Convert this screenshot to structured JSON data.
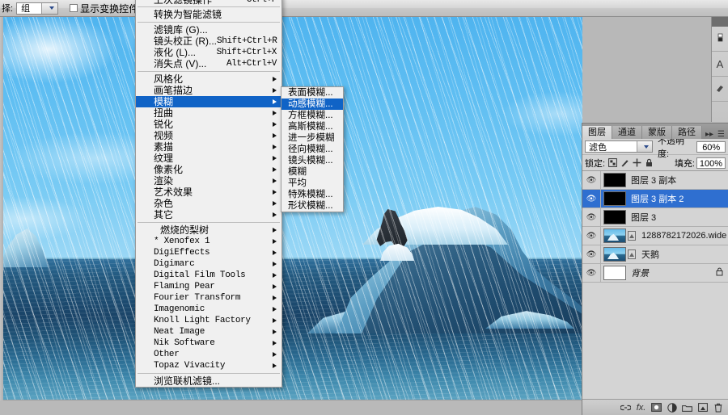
{
  "options_bar": {
    "select_label": "择:",
    "group_value": "组",
    "show_transform_label": "显示变换控件",
    "icons": [
      "align-left-icon",
      "align-horizontal-center-icon",
      "align-right-icon",
      "distribute-icon"
    ]
  },
  "filter_menu": {
    "items": [
      {
        "label": "上次滤镜操作",
        "shortcut": "Ctrl+F",
        "type": "item",
        "cut": true
      },
      {
        "type": "sep"
      },
      {
        "label": "转换为智能滤镜",
        "shortcut": "",
        "type": "item"
      },
      {
        "type": "sep"
      },
      {
        "label": "滤镜库 (G)...",
        "shortcut": "",
        "type": "item"
      },
      {
        "label": "镜头校正 (R)...",
        "shortcut": "Shift+Ctrl+R",
        "type": "item"
      },
      {
        "label": "液化 (L)...",
        "shortcut": "Shift+Ctrl+X",
        "type": "item"
      },
      {
        "label": "消失点 (V)...",
        "shortcut": "Alt+Ctrl+V",
        "type": "item"
      },
      {
        "type": "sep"
      },
      {
        "label": "风格化",
        "type": "submenu"
      },
      {
        "label": "画笔描边",
        "type": "submenu"
      },
      {
        "label": "模糊",
        "type": "submenu",
        "highlight": true
      },
      {
        "label": "扭曲",
        "type": "submenu"
      },
      {
        "label": "锐化",
        "type": "submenu"
      },
      {
        "label": "视频",
        "type": "submenu"
      },
      {
        "label": "素描",
        "type": "submenu"
      },
      {
        "label": "纹理",
        "type": "submenu"
      },
      {
        "label": "像素化",
        "type": "submenu"
      },
      {
        "label": "渲染",
        "type": "submenu"
      },
      {
        "label": "艺术效果",
        "type": "submenu"
      },
      {
        "label": "杂色",
        "type": "submenu"
      },
      {
        "label": "其它",
        "type": "submenu"
      },
      {
        "type": "sep"
      },
      {
        "label": "燃烧的梨树",
        "type": "submenu",
        "indent": true
      },
      {
        "label": "* Xenofex 1",
        "type": "submenu",
        "mono": true
      },
      {
        "label": "DigiEffects",
        "type": "submenu",
        "mono": true
      },
      {
        "label": "Digimarc",
        "type": "submenu",
        "mono": true
      },
      {
        "label": "Digital Film Tools",
        "type": "submenu",
        "mono": true
      },
      {
        "label": "Flaming Pear",
        "type": "submenu",
        "mono": true
      },
      {
        "label": "Fourier Transform",
        "type": "submenu",
        "mono": true
      },
      {
        "label": "Imagenomic",
        "type": "submenu",
        "mono": true
      },
      {
        "label": "Knoll Light Factory",
        "type": "submenu",
        "mono": true
      },
      {
        "label": "Neat Image",
        "type": "submenu",
        "mono": true
      },
      {
        "label": "Nik Software",
        "type": "submenu",
        "mono": true
      },
      {
        "label": "Other",
        "type": "submenu",
        "mono": true
      },
      {
        "label": "Topaz Vivacity",
        "type": "submenu",
        "mono": true
      },
      {
        "type": "sep"
      },
      {
        "label": "浏览联机滤镜...",
        "type": "item"
      }
    ]
  },
  "blur_submenu": {
    "items": [
      {
        "label": "表面模糊..."
      },
      {
        "label": "动感模糊...",
        "highlight": true
      },
      {
        "label": "方框模糊..."
      },
      {
        "label": "高斯模糊..."
      },
      {
        "label": "进一步模糊"
      },
      {
        "label": "径向模糊..."
      },
      {
        "label": "镜头模糊..."
      },
      {
        "label": "模糊"
      },
      {
        "label": "平均"
      },
      {
        "label": "特殊模糊..."
      },
      {
        "label": "形状模糊..."
      }
    ]
  },
  "right_strip": {
    "buttons": [
      "color-swatch-icon",
      "character-icon",
      "brush-preset-icon"
    ]
  },
  "layers_panel": {
    "tabs": [
      {
        "label": "图层",
        "active": true
      },
      {
        "label": "通道",
        "active": false
      },
      {
        "label": "蒙版",
        "active": false
      },
      {
        "label": "路径",
        "active": false
      }
    ],
    "collapse_icon": "double-chevron-right-icon",
    "menu_icon": "panel-menu-icon",
    "blend_mode": "滤色",
    "opacity_label": "不透明度:",
    "opacity_value": "60%",
    "lock_label": "锁定:",
    "lock_icons": [
      "lock-transparent-icon",
      "lock-image-icon",
      "lock-position-icon",
      "lock-all-icon"
    ],
    "fill_label": "填充:",
    "fill_value": "100%",
    "layers": [
      {
        "name": "图层 3 副本",
        "thumb": "black",
        "selected": false,
        "visible": true,
        "locked": false,
        "linked": false
      },
      {
        "name": "图层 3 副本 2",
        "thumb": "black",
        "selected": true,
        "visible": true,
        "locked": false,
        "linked": false
      },
      {
        "name": "图层 3",
        "thumb": "black",
        "selected": false,
        "visible": true,
        "locked": false,
        "linked": false
      },
      {
        "name": "1288782172026.wide",
        "thumb": "photo",
        "selected": false,
        "visible": true,
        "locked": false,
        "linked": true
      },
      {
        "name": "天鹅",
        "thumb": "photo",
        "selected": false,
        "visible": true,
        "locked": false,
        "linked": true
      },
      {
        "name": "背景",
        "thumb": "white",
        "selected": false,
        "visible": true,
        "locked": true,
        "linked": false,
        "italic": true
      }
    ],
    "footer_buttons": [
      "link-layers-icon",
      "layer-style-fx-icon",
      "add-mask-icon",
      "adjustment-layer-icon",
      "new-group-icon",
      "new-layer-icon",
      "delete-layer-icon"
    ]
  },
  "canvas": {
    "description": "iceberg-with-animal-in-rain-photo"
  }
}
